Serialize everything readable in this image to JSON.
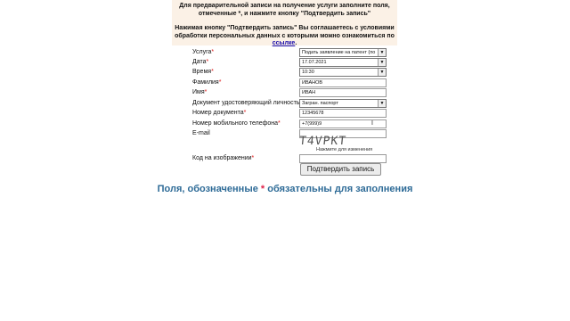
{
  "notice": {
    "line1": "Для предварительной записи на получение услуги заполните поля,",
    "line2": "отмеченные *, и нажмите кнопку \"Подтвердить запись\"",
    "line3": "Нажимая кнопку \"Подтвердить запись\" Вы соглашаетесь с условиями",
    "line4": "обработки персональных данных с которыми можно ознакомиться по",
    "link": "ссылке",
    "period": "."
  },
  "form": {
    "service": {
      "label": "Услуга",
      "value": "Подать заявление на патент (по"
    },
    "date": {
      "label": "Дата",
      "value": "17.07.2021"
    },
    "time": {
      "label": "Время",
      "value": "10:30"
    },
    "lastname": {
      "label": "Фамилия",
      "value": "ИВАНОВ"
    },
    "firstname": {
      "label": "Имя",
      "value": "ИВАН"
    },
    "doc_type": {
      "label": "Документ удостоверяющий личность",
      "value": "Загран. паспорт"
    },
    "doc_number": {
      "label": "Номер документа",
      "value": "12345678"
    },
    "phone": {
      "label": "Номер мобильного телефона",
      "value": "+7(999)9"
    },
    "email": {
      "label": "E-mail",
      "value": ""
    },
    "captcha_text": "T4VPKT",
    "captcha_hint": "Нажмите для изменения",
    "captcha_code": {
      "label": "Код на изображении",
      "value": ""
    },
    "required_mark": "*",
    "submit_label": "Подтвердить запись"
  },
  "footer": {
    "before": "Поля, обозначенные ",
    "star": "*",
    "after": " обязательны для заполнения"
  }
}
